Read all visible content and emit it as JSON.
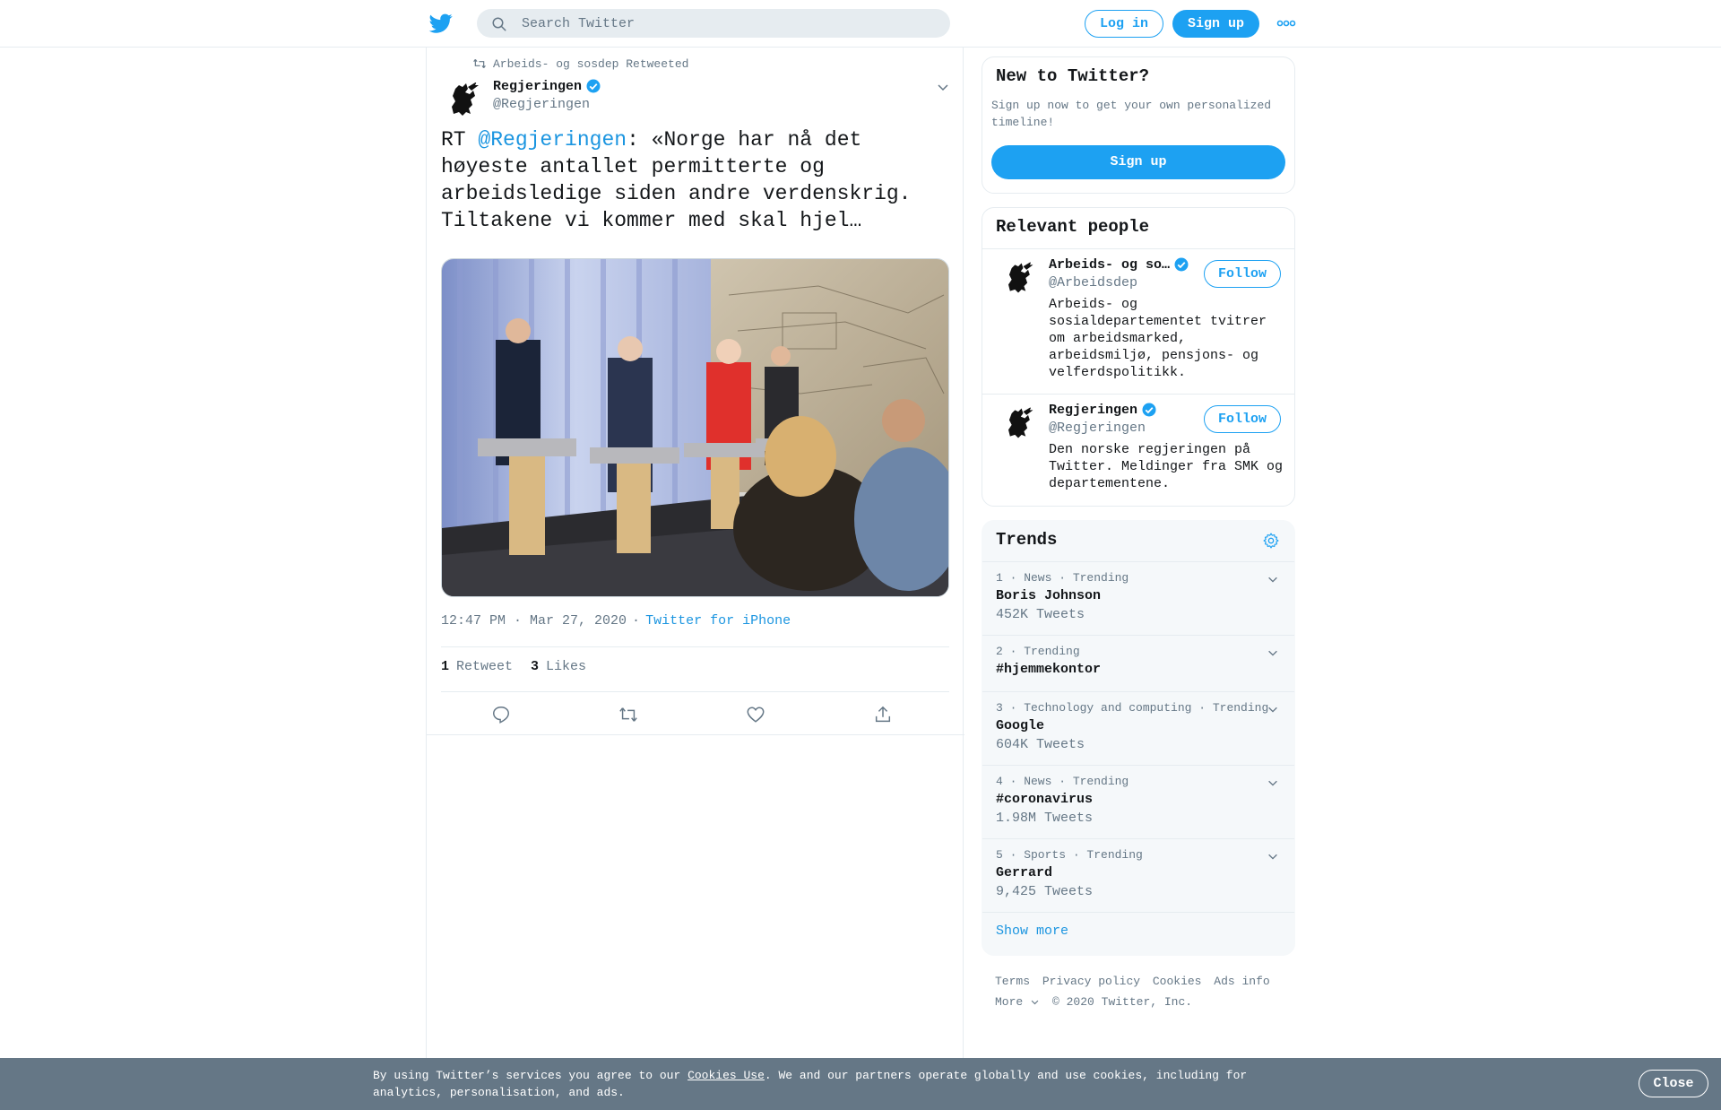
{
  "header": {
    "search_placeholder": "Search Twitter",
    "login_label": "Log in",
    "signup_label": "Sign up"
  },
  "tweet": {
    "retweeted_by": "Arbeids- og sosdep Retweeted",
    "author_name": "Regjeringen",
    "author_handle": "@Regjeringen",
    "text_prefix": "RT ",
    "text_mention": "@Regjeringen",
    "text_body": ": «Norge har nå det høyeste antallet permitterte og arbeidsledige siden andre verdenskrig. Tiltakene vi kommer med skal hjel…",
    "time": "12:47 PM · Mar 27, 2020",
    "dot": "·",
    "source": "Twitter for iPhone",
    "retweet_count": "1",
    "retweet_label": "Retweet",
    "like_count": "3",
    "like_label": "Likes"
  },
  "new_to_twitter": {
    "title": "New to Twitter?",
    "subtitle": "Sign up now to get your own personalized timeline!",
    "signup_label": "Sign up"
  },
  "relevant_people": {
    "title": "Relevant people",
    "people": [
      {
        "name": "Arbeids- og so…",
        "handle": "@Arbeidsdep",
        "bio": "Arbeids- og sosialdepartementet tvitrer om arbeidsmarked, arbeidsmiljø, pensjons- og velferdspolitikk.",
        "follow_label": "Follow"
      },
      {
        "name": "Regjeringen",
        "handle": "@Regjeringen",
        "bio": "Den norske regjeringen på Twitter. Meldinger fra SMK og departementene.",
        "follow_label": "Follow"
      }
    ]
  },
  "trends": {
    "title": "Trends",
    "items": [
      {
        "meta": "1 · News · Trending",
        "name": "Boris Johnson",
        "count": "452K Tweets"
      },
      {
        "meta": "2 · Trending",
        "name": "#hjemmekontor",
        "count": ""
      },
      {
        "meta": "3 · Technology and computing · Trending",
        "name": "Google",
        "count": "604K Tweets"
      },
      {
        "meta": "4 · News · Trending",
        "name": "#coronavirus",
        "count": "1.98M Tweets"
      },
      {
        "meta": "5 · Sports · Trending",
        "name": "Gerrard",
        "count": "9,425 Tweets"
      }
    ],
    "show_more": "Show more"
  },
  "footer": {
    "terms": "Terms",
    "privacy": "Privacy policy",
    "cookies": "Cookies",
    "ads": "Ads info",
    "more": "More",
    "copyright": "© 2020 Twitter, Inc."
  },
  "cookie_banner": {
    "text_before": "By using Twitter’s services you agree to our ",
    "link": "Cookies Use",
    "text_after": ". We and our partners operate globally and use cookies, including for analytics, personalisation, and ads.",
    "close_label": "Close"
  },
  "colors": {
    "brand_blue": "#1da1f2",
    "link_blue": "#1b95e0",
    "secondary_text": "#657786",
    "banner_bg": "#657786"
  }
}
